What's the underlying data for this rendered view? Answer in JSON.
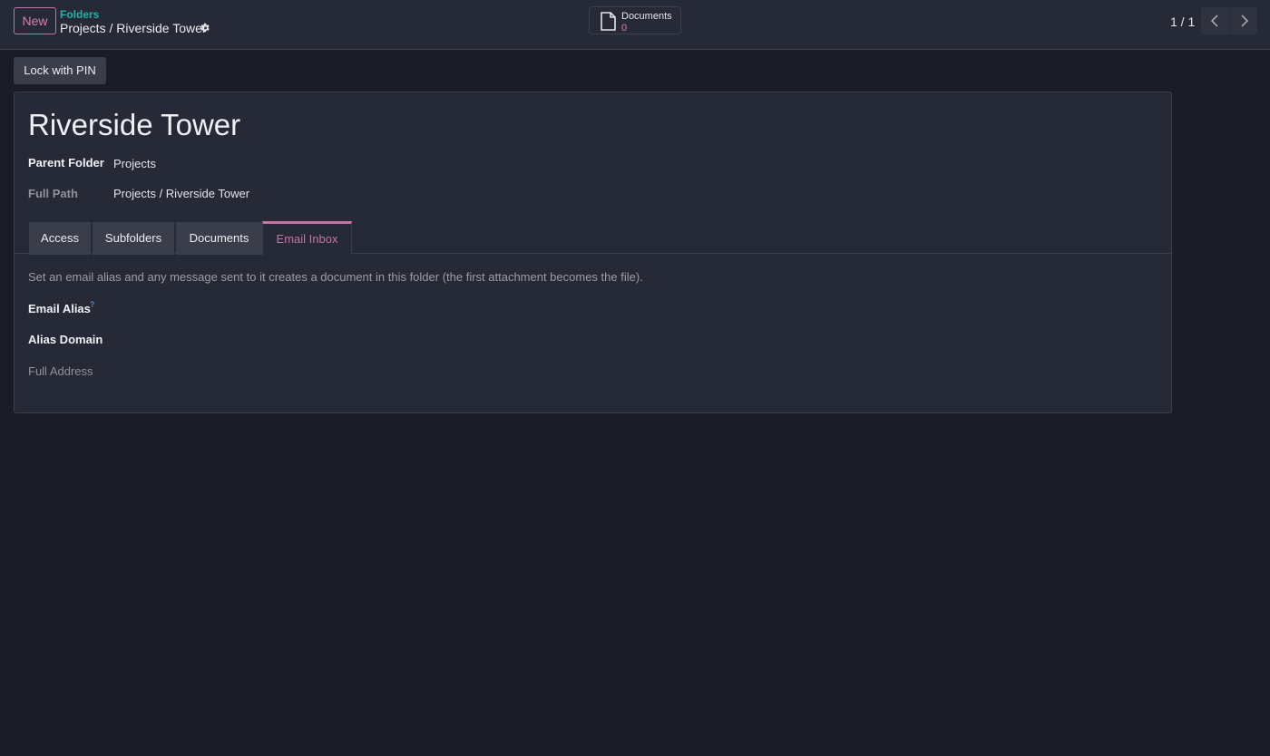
{
  "header": {
    "new_label": "New",
    "breadcrumb_parent": "Folders",
    "breadcrumb_current": "Projects / Riverside Tower",
    "smart_button": {
      "label": "Documents",
      "count": "0"
    },
    "pager": "1 / 1"
  },
  "statusbar": {
    "lock_label": "Lock with PIN"
  },
  "form": {
    "title": "Riverside Tower",
    "parent_folder_label": "Parent Folder",
    "parent_folder_value": "Projects",
    "full_path_label": "Full Path",
    "full_path_value": "Projects / Riverside Tower",
    "tabs": [
      {
        "label": "Access"
      },
      {
        "label": "Subfolders"
      },
      {
        "label": "Documents"
      },
      {
        "label": "Email Inbox",
        "active": true
      }
    ],
    "email_tab": {
      "help_text": "Set an email alias and any message sent to it creates a document in this folder (the first attachment becomes the file).",
      "email_alias_label": "Email Alias",
      "tooltip_mark": "?",
      "alias_domain_label": "Alias Domain",
      "full_address_label": "Full Address"
    }
  },
  "colors": {
    "accent": "#c373a8",
    "breadcrumb": "#1fb2a6",
    "background": "#1b1d26",
    "panel": "#262a36"
  },
  "icons": [
    "gear-icon",
    "document-icon",
    "chevron-left-icon",
    "chevron-right-icon"
  ]
}
